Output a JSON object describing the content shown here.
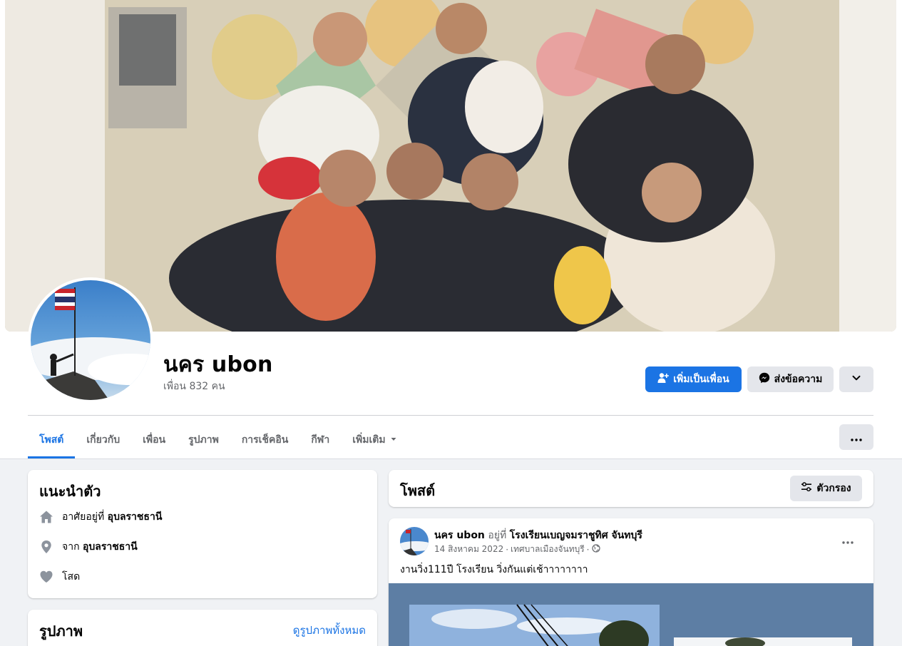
{
  "profile": {
    "name": "นคร ubon",
    "friends_text": "เพื่อน 832 คน"
  },
  "actions": {
    "add_friend": "เพิ่มเป็นเพื่อน",
    "message": "ส่งข้อความ"
  },
  "tabs": [
    {
      "label": "โพสต์",
      "active": true
    },
    {
      "label": "เกี่ยวกับ",
      "active": false
    },
    {
      "label": "เพื่อน",
      "active": false
    },
    {
      "label": "รูปภาพ",
      "active": false
    },
    {
      "label": "การเช็คอิน",
      "active": false
    },
    {
      "label": "กีฬา",
      "active": false
    },
    {
      "label": "เพิ่มเติม",
      "active": false
    }
  ],
  "intro": {
    "title": "แนะนำตัว",
    "lives_prefix": "อาศัยอยู่ที่",
    "lives_place": "อุบลราชธานี",
    "from_prefix": "จาก",
    "from_place": "อุบลราชธานี",
    "relationship": "โสด"
  },
  "photos": {
    "title": "รูปภาพ",
    "see_all": "ดูรูปภาพทั้งหมด"
  },
  "posts": {
    "title": "โพสต์",
    "filter_label": "ตัวกรอง"
  },
  "post": {
    "author": "นคร ubon",
    "at_word": "อยู่ที่",
    "place": "โรงเรียนเบญจมราชูทิศ จันทบุรี",
    "date": "14 สิงหาคม 2022",
    "location": "เทศบาลเมืองจันทบุรี",
    "separator": "·",
    "text": "งานวิ่ง111ปี โรงเรียน วิ่งกันแต่เช้าาาาาาาา"
  },
  "colors": {
    "accent": "#1b74e4",
    "background": "#f0f2f5",
    "secondary_text": "#65676b"
  }
}
